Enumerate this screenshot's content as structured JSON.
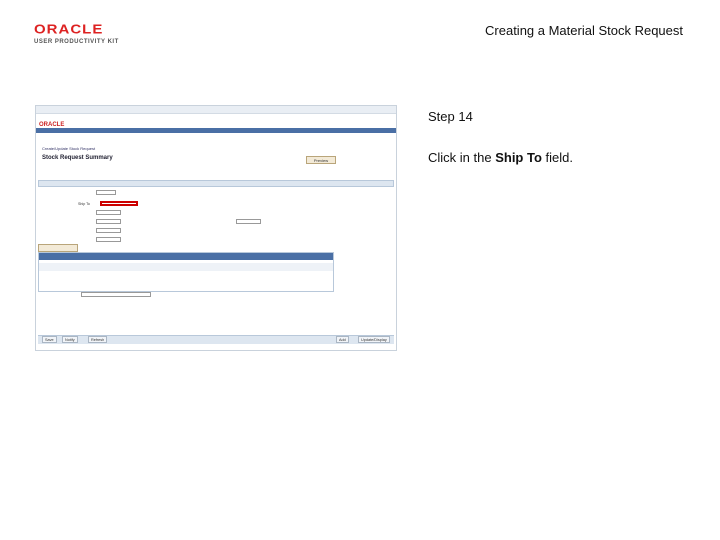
{
  "header": {
    "logo_brand": "ORACLE",
    "logo_tagline": "USER PRODUCTIVITY KIT",
    "title": "Creating a Material Stock Request"
  },
  "panel": {
    "step": "Step 14",
    "instruction_prefix": "Click in the ",
    "instruction_field": "Ship To",
    "instruction_suffix": " field."
  },
  "screenshot": {
    "oracle": "ORACLE",
    "breadcrumbs": "Create/Update Stock Request",
    "page_heading": "Stock Request Summary",
    "save_button": "Preview",
    "ship_to_label": "Ship To",
    "footer_buttons": [
      "Save",
      "Notify",
      "Refresh",
      "Add",
      "Update/Display"
    ]
  },
  "colors": {
    "highlight": "#cc0000",
    "nav_blue": "#4a6fa5",
    "brand_red": "#d22222"
  }
}
